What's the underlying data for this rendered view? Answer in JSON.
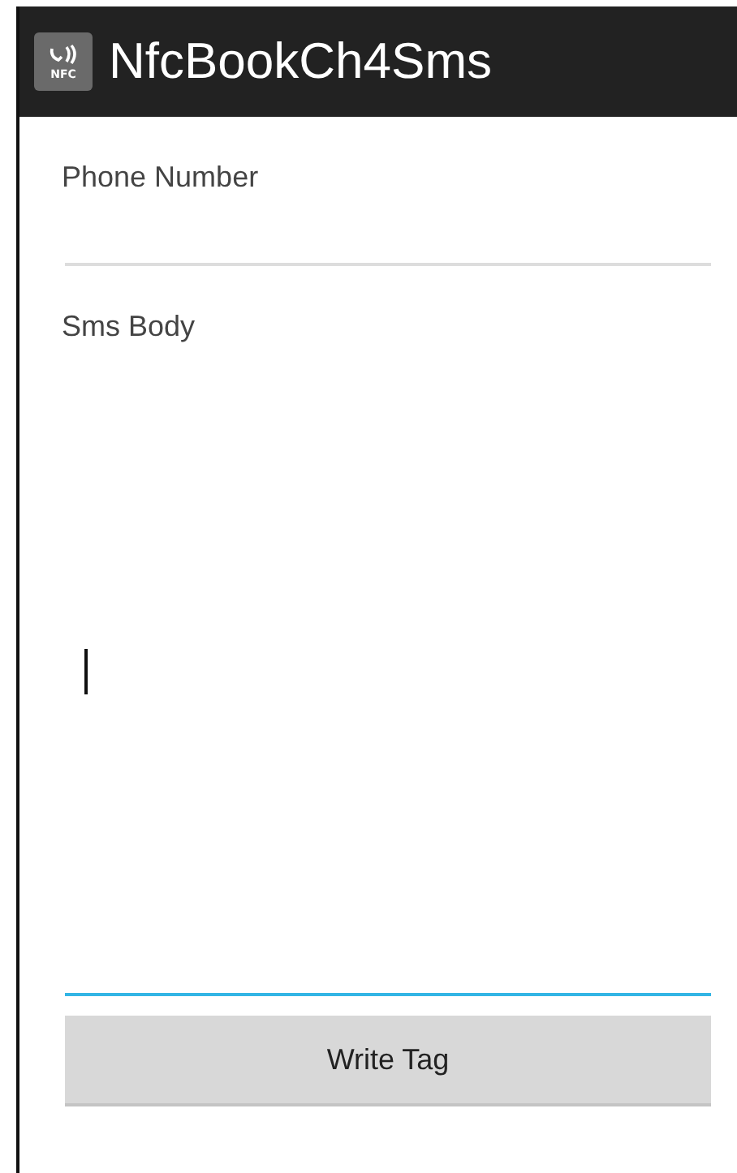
{
  "action_bar": {
    "title": "NfcBookCh4Sms",
    "icon_text": "NFC"
  },
  "fields": [
    {
      "label": "Phone Number",
      "focused": false,
      "multiline": false
    },
    {
      "label": "Sms Body",
      "focused": true,
      "multiline": true
    }
  ],
  "button": {
    "label": "Write Tag"
  }
}
